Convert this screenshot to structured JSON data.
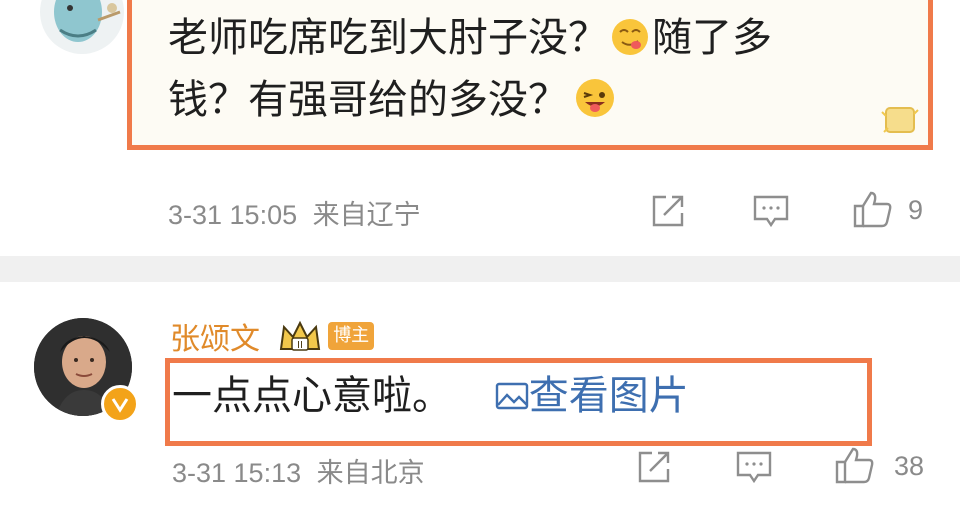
{
  "comment_1": {
    "text_line1": "老师吃席吃到大肘子没？",
    "text_line1b": "随了多",
    "text_line2": "钱？有强哥给的多没？",
    "date": "3-31 15:05",
    "location": "来自辽宁",
    "like_count": "9"
  },
  "comment_2": {
    "username": "张颂文",
    "badge": "博主",
    "text": "一点点心意啦。",
    "image_link": "查看图片",
    "date": "3-31 15:13",
    "location": "来自北京",
    "like_count": "38"
  },
  "colors": {
    "highlight": "#f07a4a",
    "username": "#e08a2a",
    "link": "#3e6fb0",
    "meta": "#8a8a8a"
  }
}
